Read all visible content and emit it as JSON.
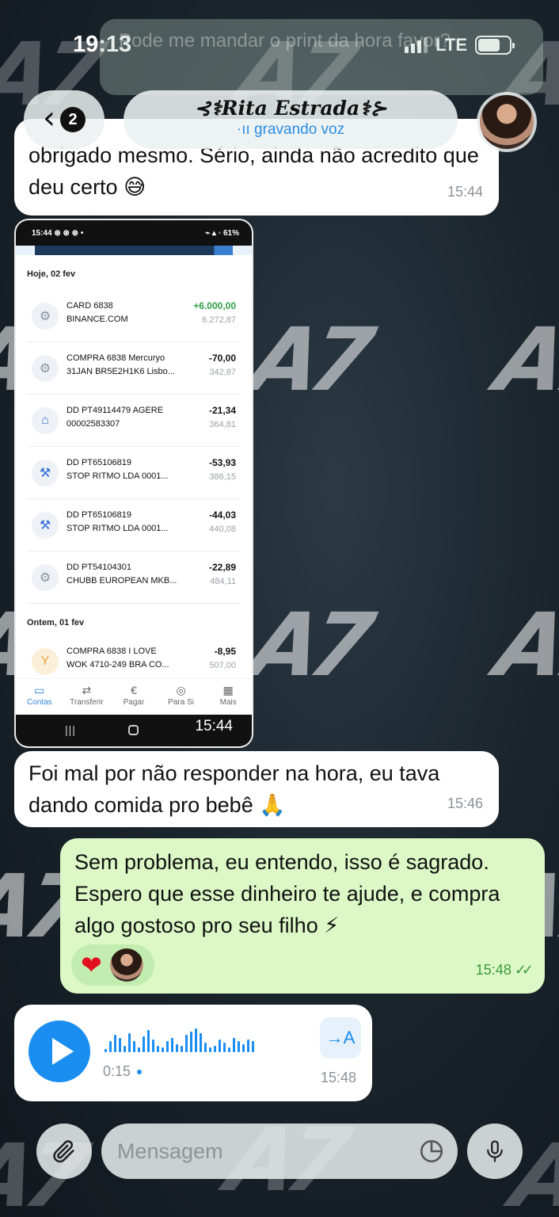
{
  "status_bar": {
    "time": "19:13",
    "network": "LTE"
  },
  "ghost_bubble": {
    "text": "Pode me mandar o print da hora favor?"
  },
  "header": {
    "back_badge": "2",
    "contact_name": "⊰⚕Rita Estrada⚕⊱",
    "contact_status": "gravando voz"
  },
  "messages": {
    "m1": {
      "text": "obrigado mesmo. Sério, ainda não acredito que deu certo 😅",
      "time": "15:44"
    },
    "m2_screenshot": {
      "time": "15:44",
      "phone_status_time": "15:44",
      "phone_status_icons": "⊛ ⊛ ⊛ •",
      "phone_battery": "61%",
      "sections": [
        {
          "date": "Hoje, 02 fev",
          "transactions": [
            {
              "icon": "gear-icon",
              "line1": "CARD 6838",
              "line2": "BINANCE.COM",
              "amount": "+6.000,00",
              "balance": "6.272,87",
              "positive": true
            },
            {
              "icon": "gear-icon",
              "line1": "COMPRA 6838 Mercuryo",
              "line2": "31JAN BR5E2H1K6 Lisbo...",
              "amount": "-70,00",
              "balance": "342,87",
              "positive": false
            },
            {
              "icon": "home-icon",
              "line1": "DD PT49114479 AGERE",
              "line2": "00002583307",
              "amount": "-21,34",
              "balance": "364,81",
              "positive": false
            },
            {
              "icon": "dumbbell-icon",
              "line1": "DD PT65106819",
              "line2": "STOP RITMO LDA 0001...",
              "amount": "-53,93",
              "balance": "386,15",
              "positive": false
            },
            {
              "icon": "dumbbell-icon",
              "line1": "DD PT65106819",
              "line2": "STOP RITMO LDA 0001...",
              "amount": "-44,03",
              "balance": "440,08",
              "positive": false
            },
            {
              "icon": "gear-icon",
              "line1": "DD PT54104301",
              "line2": "CHUBB EUROPEAN MKB...",
              "amount": "-22,89",
              "balance": "484,11",
              "positive": false
            }
          ]
        },
        {
          "date": "Ontem, 01 fev",
          "transactions": [
            {
              "icon": "cocktail-icon",
              "line1": "COMPRA 6838 I LOVE",
              "line2": "WOK 4710-249 BRA CO...",
              "amount": "-8,95",
              "balance": "507,00",
              "positive": false
            }
          ]
        }
      ],
      "nav": [
        {
          "label": "Contas",
          "icon": "accounts-icon",
          "active": true
        },
        {
          "label": "Transferir",
          "icon": "transfer-icon",
          "active": false
        },
        {
          "label": "Pagar",
          "icon": "euro-icon",
          "active": false
        },
        {
          "label": "Para Si",
          "icon": "compass-icon",
          "active": false
        },
        {
          "label": "Mais",
          "icon": "grid-icon",
          "active": false
        }
      ]
    },
    "m3": {
      "text": "Foi mal por não responder na hora, eu tava dando comida pro bebê 🙏",
      "time": "15:46"
    },
    "m4": {
      "text": "Sem problema, eu entendo, isso é sagrado. Espero que esse dinheiro te ajude, e compra algo gostoso pro seu filho ⚡",
      "time": "15:48",
      "reaction": "❤"
    },
    "m5": {
      "duration": "0:15",
      "time": "15:48",
      "translate_label": "→A"
    }
  },
  "composer": {
    "placeholder": "Mensagem"
  },
  "colors": {
    "outgoing_bubble": "#dcf8c6",
    "accent_blue": "#1a8ef0",
    "positive_amount": "#2e9e46"
  }
}
